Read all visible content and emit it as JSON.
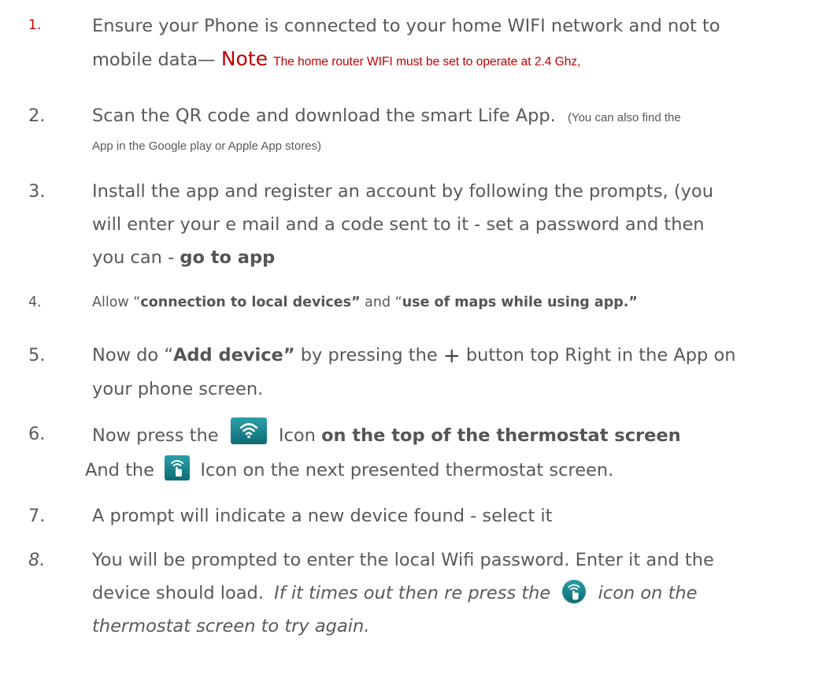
{
  "colors": {
    "text": "#595959",
    "accent_red": "#c00000",
    "icon_teal": "#1a8a94"
  },
  "steps": [
    {
      "num": "1.",
      "line1": "Ensure your Phone is connected to your home WIFI network and not to",
      "line2_a": "mobile data—",
      "note_word": "Note",
      "note_text": "The home router WIFI must be set to operate  at   2.4 Ghz,"
    },
    {
      "num": "2.",
      "line1_a": "Scan the QR code and download the smart Life App.",
      "line1_b": "(You can also find the",
      "line2": "App in the Google play or Apple App stores)"
    },
    {
      "num": "3.",
      "line1": "Install the app and register an account by following the prompts, (you",
      "line2": "will enter your e mail and a code sent to it  - set a password and then",
      "line3_a": "you can -",
      "line3_bold": "go to app"
    },
    {
      "num": "4.",
      "a": "Allow “",
      "bold1": "connection to local devices”",
      "b": " and “",
      "bold2": "use of maps while using app.”"
    },
    {
      "num": "5.",
      "a": "Now do “",
      "bold": "Add device”",
      "b": " by pressing the ",
      "plus": "+",
      "c": " button top Right in the App on",
      "line2": "your phone screen."
    },
    {
      "num": "6.",
      "a": "Now press the",
      "b": "Icon",
      "bold": "on the top of the thermostat screen",
      "line2_a": "And the",
      "line2_b": "Icon on the next presented thermostat screen.",
      "icon1": "wifi-icon",
      "icon2": "wifi-hand-icon"
    },
    {
      "num": "7.",
      "text": "A prompt will indicate a new device found - select it"
    },
    {
      "num": "8.",
      "line1": "You will be prompted to enter the local Wifi password. Enter it and the",
      "line2_a": "device should load.",
      "line2_italic_a": "If it times out then re press the",
      "line2_italic_b": "icon on the",
      "line3_italic": "thermostat screen to try again.",
      "icon": "wifi-hand-icon"
    }
  ]
}
